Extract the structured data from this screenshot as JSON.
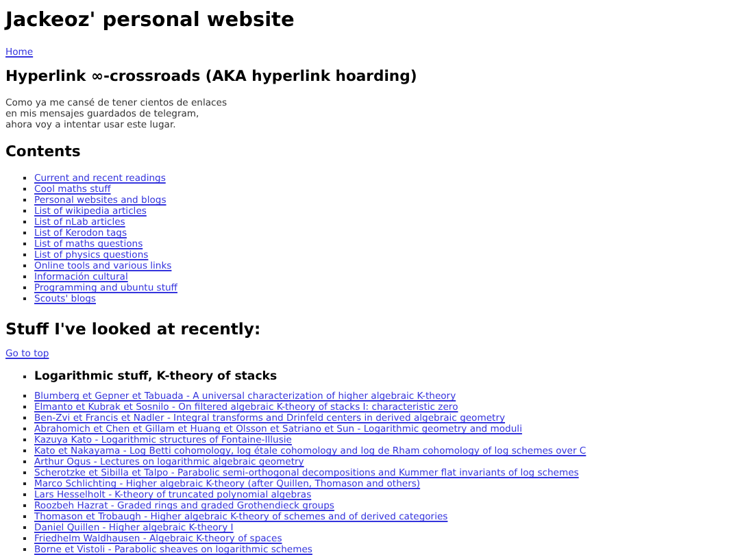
{
  "site_title": "Jackeoz' personal website",
  "home_link": "Home",
  "page_title": "Hyperlink ∞-crossroads (AKA hyperlink hoarding)",
  "intro_lines": [
    "Como ya me cansé de tener cientos de enlaces",
    "en mis mensajes guardados de telegram,",
    "ahora voy a intentar usar este lugar."
  ],
  "contents": {
    "heading": "Contents",
    "items": [
      "Current and recent readings",
      "Cool maths stuff",
      "Personal websites and blogs",
      "List of wikipedia articles",
      "List of nLab articles",
      "List of Kerodon tags",
      "List of maths questions",
      "List of physics questions",
      "Online tools and various links",
      "Información cultural",
      "Programming and ubuntu stuff",
      "Scouts' blogs"
    ]
  },
  "recent": {
    "heading": "Stuff I've looked at recently:",
    "top_link": "Go to top",
    "sections": [
      {
        "title": "Logarithmic stuff, K-theory of stacks",
        "links": [
          "Blumberg et Gepner et Tabuada - A universal characterization of higher algebraic K-theory",
          "Elmanto et Kubrak et Sosnilo - On filtered algebraic K-theory of stacks I: characteristic zero",
          "Ben-Zvi et Francis et Nadler - Integral transforms and Drinfeld centers in derived algebraic geometry",
          "Abrahomich et Chen et Gillam et Huang et Olsson et Satriano et Sun - Logarithmic geometry and moduli",
          "Kazuya Kato - Logarithmic structures of Fontaine-Illusie",
          "Kato et Nakayama - Log Betti cohomology, log étale cohomology and log de Rham cohomology of log schemes over C",
          "Arthur Ogus - Lectures on logarithmic algebraic geometry",
          "Scherotzke et Sibilla et Talpo - Parabolic semi-orthogonal decompositions and Kummer flat invariants of log schemes",
          "Marco Schlichting - Higher algebraic K-theory (after Quillen, Thomason and others)",
          "Lars Hesselholt - K-theory of truncated polynomial algebras",
          "Roozbeh Hazrat - Graded rings and graded Grothendieck groups",
          "Thomason et Trobaugh - Higher algebraic K-theory of schemes and of derived categories",
          "Daniel Quillen - Higher algebraic K-theory I",
          "Friedhelm Waldhausen - Algebraic K-theory of spaces",
          "Borne et Vistoli - Parabolic sheaves on logarithmic schemes"
        ]
      }
    ]
  }
}
